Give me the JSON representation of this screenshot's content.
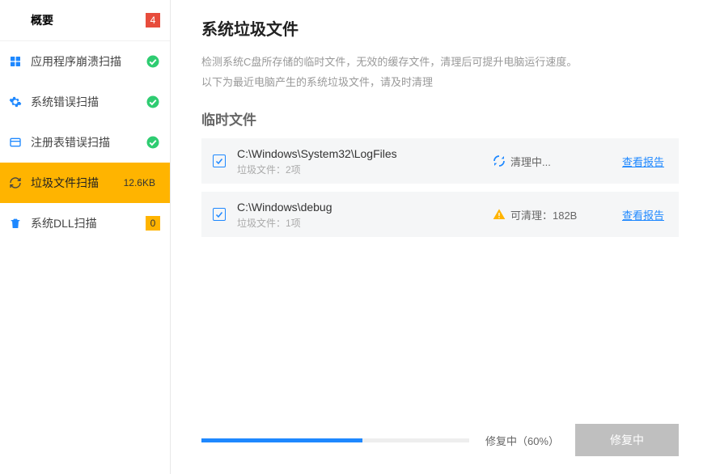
{
  "sidebar": {
    "overview": {
      "label": "概要",
      "badge": "4"
    },
    "items": [
      {
        "id": "crash",
        "label": "应用程序崩溃扫描",
        "status": "ok"
      },
      {
        "id": "syserr",
        "label": "系统错误扫描",
        "status": "ok"
      },
      {
        "id": "registry",
        "label": "注册表错误扫描",
        "status": "ok"
      },
      {
        "id": "junk",
        "label": "垃圾文件扫描",
        "status": "size",
        "badge": "12.6KB",
        "active": true
      },
      {
        "id": "dll",
        "label": "系统DLL扫描",
        "status": "count",
        "badge": "0"
      }
    ]
  },
  "main": {
    "title": "系统垃圾文件",
    "desc_line1": "检测系统C盘所存储的临时文件，无效的缓存文件，清理后可提升电脑运行速度。",
    "desc_line2": "以下为最近电脑产生的系统垃圾文件，请及时清理",
    "section": "临时文件",
    "report_label": "查看报告",
    "files": [
      {
        "path": "C:\\Windows\\System32\\LogFiles",
        "sub": "垃圾文件：2项",
        "status_kind": "cleaning",
        "status_text": "清理中..."
      },
      {
        "path": "C:\\Windows\\debug",
        "sub": "垃圾文件：1项",
        "status_kind": "warn",
        "status_text": "可清理：182B"
      }
    ],
    "progress": {
      "percent": 60,
      "text": "修复中（60%）"
    },
    "repair_btn": "修复中"
  },
  "colors": {
    "accent": "#1e88ff",
    "warn": "#ffb400",
    "danger": "#e74c3c",
    "disabled": "#bfbfbf"
  }
}
